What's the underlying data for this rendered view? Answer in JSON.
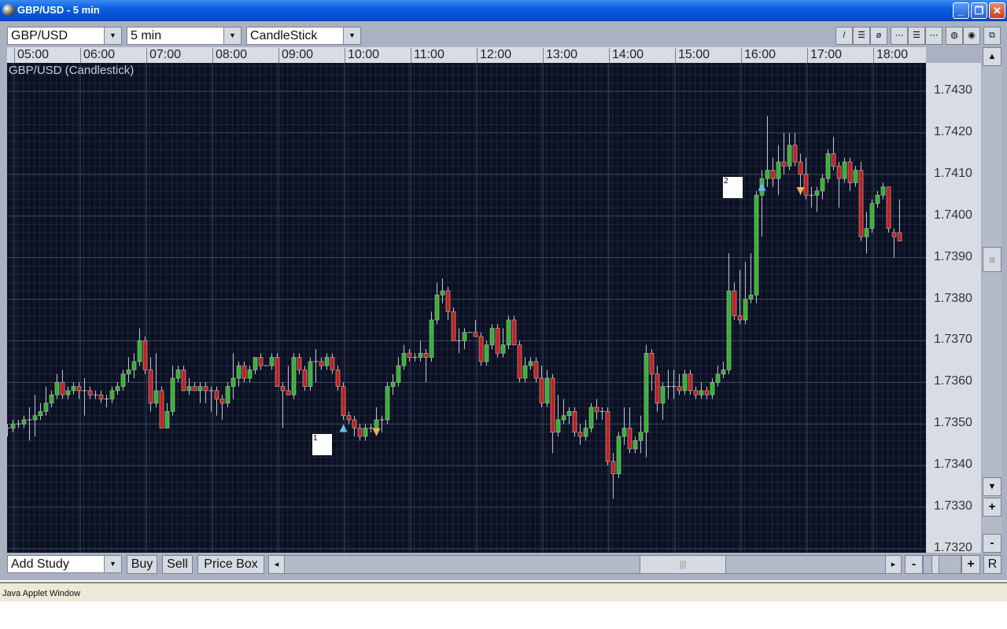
{
  "window": {
    "title": "GBP/USD - 5 min",
    "minimize": "_",
    "restore": "❐",
    "close": "✕"
  },
  "toolbar": {
    "symbol": "GBP/USD",
    "interval": "5 min",
    "chart_type": "CandleStick",
    "tools": [
      {
        "name": "line-tool",
        "glyph": "/"
      },
      {
        "name": "hline-tool",
        "glyph": "☰"
      },
      {
        "name": "ellipse-tool",
        "glyph": "ø"
      },
      {
        "name": "grid-dash-1",
        "glyph": "⋯"
      },
      {
        "name": "grid-dash-2",
        "glyph": "☰"
      },
      {
        "name": "grid-dash-3",
        "glyph": "⋯"
      },
      {
        "name": "circle-light",
        "glyph": "◍"
      },
      {
        "name": "circle-dark",
        "glyph": "◉"
      },
      {
        "name": "detach",
        "glyph": "⧉"
      }
    ]
  },
  "time_axis": [
    "05:00",
    "06:00",
    "07:00",
    "08:00",
    "09:00",
    "10:00",
    "11:00",
    "12:00",
    "13:00",
    "14:00",
    "15:00",
    "16:00",
    "17:00",
    "18:00"
  ],
  "chart_title": "GBP/USD (Candlestick)",
  "price_axis": [
    "1.7430",
    "1.7420",
    "1.7410",
    "1.7400",
    "1.7390",
    "1.7380",
    "1.7370",
    "1.7360",
    "1.7350",
    "1.7340",
    "1.7330",
    "1.7320"
  ],
  "markers": [
    {
      "label": "1",
      "index": 56
    },
    {
      "label": "2",
      "index": 131
    }
  ],
  "signals": [
    {
      "type": "buy",
      "index": 61,
      "price": 1.7349
    },
    {
      "type": "sell",
      "index": 67,
      "price": 1.7348
    },
    {
      "type": "buy",
      "index": 137,
      "price": 1.7407
    },
    {
      "type": "sell",
      "index": 144,
      "price": 1.7406
    }
  ],
  "bottom": {
    "add_study": "Add Study",
    "buy": "Buy",
    "sell": "Sell",
    "price_box": "Price Box",
    "zoom_out": "-",
    "zoom_in": "+",
    "reset": "R",
    "scroll_left": "◂",
    "scroll_right": "▸",
    "thumb": "|||"
  },
  "scroll": {
    "up": "▲",
    "down": "▼",
    "plus": "+",
    "minus": "-",
    "thumb": "≡"
  },
  "status": "Java Applet Window",
  "colors": {
    "up": "#2db82d",
    "down": "#c41e1e",
    "wick": "#b8bcc8",
    "buy": "#6ab8f0",
    "sell": "#f0b060"
  },
  "chart_data": {
    "type": "candlestick",
    "title": "GBP/USD (Candlestick)",
    "interval": "5 min",
    "ylim": [
      1.7318,
      1.7442
    ],
    "ohlc": [
      [
        1.7349,
        1.735,
        1.7347,
        1.7349
      ],
      [
        1.7349,
        1.7351,
        1.7348,
        1.735
      ],
      [
        1.735,
        1.7351,
        1.7349,
        1.735
      ],
      [
        1.735,
        1.7352,
        1.7349,
        1.7351
      ],
      [
        1.7351,
        1.7354,
        1.7346,
        1.7351
      ],
      [
        1.7351,
        1.7357,
        1.7347,
        1.7352
      ],
      [
        1.7352,
        1.7355,
        1.7351,
        1.7353
      ],
      [
        1.7353,
        1.7359,
        1.7352,
        1.7355
      ],
      [
        1.7355,
        1.7358,
        1.7354,
        1.7357
      ],
      [
        1.7357,
        1.7362,
        1.7356,
        1.736
      ],
      [
        1.736,
        1.7363,
        1.7356,
        1.7357
      ],
      [
        1.7357,
        1.7359,
        1.7356,
        1.7358
      ],
      [
        1.7358,
        1.736,
        1.7357,
        1.7359
      ],
      [
        1.7359,
        1.736,
        1.7356,
        1.7358
      ],
      [
        1.7358,
        1.7361,
        1.7352,
        1.7358
      ],
      [
        1.7358,
        1.7359,
        1.7356,
        1.7357
      ],
      [
        1.7357,
        1.7358,
        1.7356,
        1.7357
      ],
      [
        1.7357,
        1.7358,
        1.7355,
        1.7356
      ],
      [
        1.7356,
        1.7357,
        1.7354,
        1.7356
      ],
      [
        1.7356,
        1.7359,
        1.7355,
        1.7358
      ],
      [
        1.7358,
        1.736,
        1.7357,
        1.7359
      ],
      [
        1.7359,
        1.7363,
        1.7358,
        1.7362
      ],
      [
        1.7362,
        1.7366,
        1.736,
        1.7363
      ],
      [
        1.7363,
        1.7367,
        1.7361,
        1.7365
      ],
      [
        1.7365,
        1.7373,
        1.7364,
        1.737
      ],
      [
        1.737,
        1.7371,
        1.7362,
        1.7363
      ],
      [
        1.7363,
        1.7366,
        1.7353,
        1.7355
      ],
      [
        1.7355,
        1.7367,
        1.7354,
        1.7358
      ],
      [
        1.7358,
        1.7359,
        1.7349,
        1.7349
      ],
      [
        1.7349,
        1.7355,
        1.7349,
        1.7353
      ],
      [
        1.7353,
        1.7364,
        1.7352,
        1.7361
      ],
      [
        1.7361,
        1.7364,
        1.736,
        1.7363
      ],
      [
        1.7363,
        1.7364,
        1.7358,
        1.7358
      ],
      [
        1.7358,
        1.7361,
        1.7357,
        1.7359
      ],
      [
        1.7359,
        1.736,
        1.7358,
        1.7358
      ],
      [
        1.7358,
        1.736,
        1.7355,
        1.7359
      ],
      [
        1.7359,
        1.736,
        1.7355,
        1.7358
      ],
      [
        1.7358,
        1.7359,
        1.7353,
        1.7358
      ],
      [
        1.7358,
        1.7359,
        1.7352,
        1.7356
      ],
      [
        1.7356,
        1.7357,
        1.7351,
        1.7355
      ],
      [
        1.7355,
        1.736,
        1.7354,
        1.7359
      ],
      [
        1.7359,
        1.7367,
        1.7356,
        1.7361
      ],
      [
        1.7361,
        1.7365,
        1.7359,
        1.7364
      ],
      [
        1.7364,
        1.7365,
        1.736,
        1.7361
      ],
      [
        1.7361,
        1.7364,
        1.736,
        1.7363
      ],
      [
        1.7363,
        1.7366,
        1.7362,
        1.7366
      ],
      [
        1.7366,
        1.7367,
        1.7363,
        1.7364
      ],
      [
        1.7364,
        1.7364,
        1.7364,
        1.7364
      ],
      [
        1.7364,
        1.7367,
        1.7363,
        1.7366
      ],
      [
        1.7366,
        1.7367,
        1.7359,
        1.7359
      ],
      [
        1.7359,
        1.736,
        1.7349,
        1.7358
      ],
      [
        1.7358,
        1.7364,
        1.7357,
        1.7357
      ],
      [
        1.7357,
        1.7367,
        1.7356,
        1.7366
      ],
      [
        1.7366,
        1.7367,
        1.7362,
        1.7363
      ],
      [
        1.7363,
        1.7364,
        1.7358,
        1.7359
      ],
      [
        1.7359,
        1.7366,
        1.7358,
        1.7365
      ],
      [
        1.7365,
        1.7368,
        1.736,
        1.7365
      ],
      [
        1.7365,
        1.7366,
        1.7363,
        1.7364
      ],
      [
        1.7364,
        1.7367,
        1.7363,
        1.7366
      ],
      [
        1.7366,
        1.7367,
        1.7362,
        1.7363
      ],
      [
        1.7363,
        1.7364,
        1.7358,
        1.7359
      ],
      [
        1.7359,
        1.736,
        1.7351,
        1.7352
      ],
      [
        1.7352,
        1.7353,
        1.735,
        1.7351
      ],
      [
        1.7351,
        1.7352,
        1.7347,
        1.7349
      ],
      [
        1.7349,
        1.735,
        1.7346,
        1.7347
      ],
      [
        1.7347,
        1.735,
        1.7346,
        1.7349
      ],
      [
        1.7349,
        1.735,
        1.7348,
        1.7349
      ],
      [
        1.7349,
        1.7354,
        1.7348,
        1.7351
      ],
      [
        1.7351,
        1.7352,
        1.7348,
        1.7351
      ],
      [
        1.7351,
        1.736,
        1.735,
        1.7359
      ],
      [
        1.7359,
        1.7362,
        1.7357,
        1.736
      ],
      [
        1.736,
        1.7366,
        1.7359,
        1.7364
      ],
      [
        1.7364,
        1.7369,
        1.7363,
        1.7367
      ],
      [
        1.7367,
        1.7368,
        1.7365,
        1.7366
      ],
      [
        1.7366,
        1.7367,
        1.7365,
        1.7366
      ],
      [
        1.7366,
        1.737,
        1.7365,
        1.7367
      ],
      [
        1.7367,
        1.7368,
        1.736,
        1.7366
      ],
      [
        1.7366,
        1.7377,
        1.7365,
        1.7375
      ],
      [
        1.7375,
        1.7384,
        1.7374,
        1.7381
      ],
      [
        1.7381,
        1.7385,
        1.7379,
        1.7382
      ],
      [
        1.7382,
        1.7383,
        1.7375,
        1.7377
      ],
      [
        1.7377,
        1.7378,
        1.737,
        1.737
      ],
      [
        1.737,
        1.7373,
        1.7367,
        1.737
      ],
      [
        1.737,
        1.7373,
        1.7368,
        1.7372
      ],
      [
        1.7372,
        1.7372,
        1.7372,
        1.7372
      ],
      [
        1.7372,
        1.7375,
        1.7371,
        1.7371
      ],
      [
        1.7371,
        1.7372,
        1.7364,
        1.7365
      ],
      [
        1.7365,
        1.737,
        1.7364,
        1.7369
      ],
      [
        1.7369,
        1.7374,
        1.7368,
        1.7373
      ],
      [
        1.7373,
        1.7374,
        1.7366,
        1.7367
      ],
      [
        1.7367,
        1.7373,
        1.7366,
        1.7369
      ],
      [
        1.7369,
        1.7376,
        1.7368,
        1.7375
      ],
      [
        1.7375,
        1.7376,
        1.7369,
        1.7369
      ],
      [
        1.7369,
        1.737,
        1.736,
        1.7361
      ],
      [
        1.7361,
        1.7366,
        1.736,
        1.7364
      ],
      [
        1.7364,
        1.7366,
        1.7363,
        1.7365
      ],
      [
        1.7365,
        1.7366,
        1.736,
        1.7361
      ],
      [
        1.7361,
        1.7364,
        1.7354,
        1.7355
      ],
      [
        1.7355,
        1.7363,
        1.7354,
        1.7361
      ],
      [
        1.7361,
        1.7362,
        1.7343,
        1.7348
      ],
      [
        1.7348,
        1.7357,
        1.7347,
        1.7351
      ],
      [
        1.7351,
        1.7356,
        1.735,
        1.7352
      ],
      [
        1.7352,
        1.7354,
        1.735,
        1.7353
      ],
      [
        1.7353,
        1.7354,
        1.7347,
        1.7348
      ],
      [
        1.7348,
        1.735,
        1.7345,
        1.7347
      ],
      [
        1.7347,
        1.7351,
        1.7346,
        1.7349
      ],
      [
        1.7349,
        1.7355,
        1.7348,
        1.7354
      ],
      [
        1.7354,
        1.7356,
        1.7351,
        1.7353
      ],
      [
        1.7353,
        1.7354,
        1.7351,
        1.7353
      ],
      [
        1.7353,
        1.7354,
        1.734,
        1.7341
      ],
      [
        1.7341,
        1.7343,
        1.7332,
        1.7338
      ],
      [
        1.7338,
        1.7348,
        1.7337,
        1.7347
      ],
      [
        1.7347,
        1.7354,
        1.7345,
        1.7349
      ],
      [
        1.7349,
        1.7354,
        1.7343,
        1.7344
      ],
      [
        1.7344,
        1.7347,
        1.7343,
        1.7346
      ],
      [
        1.7346,
        1.7352,
        1.7343,
        1.7348
      ],
      [
        1.7348,
        1.7369,
        1.7342,
        1.7367
      ],
      [
        1.7367,
        1.7368,
        1.7358,
        1.7362
      ],
      [
        1.7362,
        1.7364,
        1.7353,
        1.7355
      ],
      [
        1.7355,
        1.736,
        1.7351,
        1.7359
      ],
      [
        1.7359,
        1.7363,
        1.7356,
        1.7359
      ],
      [
        1.7359,
        1.7363,
        1.7356,
        1.7359
      ],
      [
        1.7359,
        1.7362,
        1.7357,
        1.7358
      ],
      [
        1.7358,
        1.7363,
        1.7357,
        1.7362
      ],
      [
        1.7362,
        1.7363,
        1.7357,
        1.7358
      ],
      [
        1.7358,
        1.7359,
        1.7356,
        1.7357
      ],
      [
        1.7357,
        1.736,
        1.7356,
        1.7358
      ],
      [
        1.7358,
        1.7359,
        1.7356,
        1.7357
      ],
      [
        1.7357,
        1.7361,
        1.7356,
        1.736
      ],
      [
        1.736,
        1.7364,
        1.7359,
        1.7362
      ],
      [
        1.7362,
        1.7365,
        1.7361,
        1.7363
      ],
      [
        1.7363,
        1.7391,
        1.7362,
        1.7382
      ],
      [
        1.7382,
        1.7384,
        1.7375,
        1.7376
      ],
      [
        1.7376,
        1.7387,
        1.7374,
        1.7375
      ],
      [
        1.7375,
        1.7389,
        1.7374,
        1.738
      ],
      [
        1.738,
        1.7391,
        1.7379,
        1.7381
      ],
      [
        1.7381,
        1.7406,
        1.7379,
        1.7405
      ],
      [
        1.7405,
        1.7411,
        1.7395,
        1.7409
      ],
      [
        1.7409,
        1.7424,
        1.7407,
        1.7411
      ],
      [
        1.7411,
        1.7414,
        1.7407,
        1.7409
      ],
      [
        1.7409,
        1.7417,
        1.7405,
        1.7413
      ],
      [
        1.7413,
        1.742,
        1.741,
        1.7412
      ],
      [
        1.7412,
        1.742,
        1.7411,
        1.7417
      ],
      [
        1.7417,
        1.742,
        1.7412,
        1.7413
      ],
      [
        1.7413,
        1.7415,
        1.7405,
        1.741
      ],
      [
        1.741,
        1.7414,
        1.7404,
        1.7405
      ],
      [
        1.7405,
        1.7407,
        1.7402,
        1.7405
      ],
      [
        1.7405,
        1.7407,
        1.7401,
        1.7406
      ],
      [
        1.7406,
        1.741,
        1.7404,
        1.7409
      ],
      [
        1.7409,
        1.7416,
        1.7408,
        1.7415
      ],
      [
        1.7415,
        1.7419,
        1.7411,
        1.7412
      ],
      [
        1.7412,
        1.7413,
        1.7402,
        1.7409
      ],
      [
        1.7409,
        1.7414,
        1.7408,
        1.7413
      ],
      [
        1.7413,
        1.7414,
        1.7406,
        1.7408
      ],
      [
        1.7408,
        1.7412,
        1.7407,
        1.7411
      ],
      [
        1.7411,
        1.7413,
        1.7394,
        1.7395
      ],
      [
        1.7395,
        1.7401,
        1.7391,
        1.7397
      ],
      [
        1.7397,
        1.7404,
        1.7396,
        1.7403
      ],
      [
        1.7403,
        1.7406,
        1.7402,
        1.7405
      ],
      [
        1.7405,
        1.7408,
        1.7404,
        1.7407
      ],
      [
        1.7407,
        1.7407,
        1.7396,
        1.7397
      ],
      [
        1.7396,
        1.7397,
        1.739,
        1.7395
      ],
      [
        1.7396,
        1.7404,
        1.7394,
        1.7394
      ]
    ]
  }
}
